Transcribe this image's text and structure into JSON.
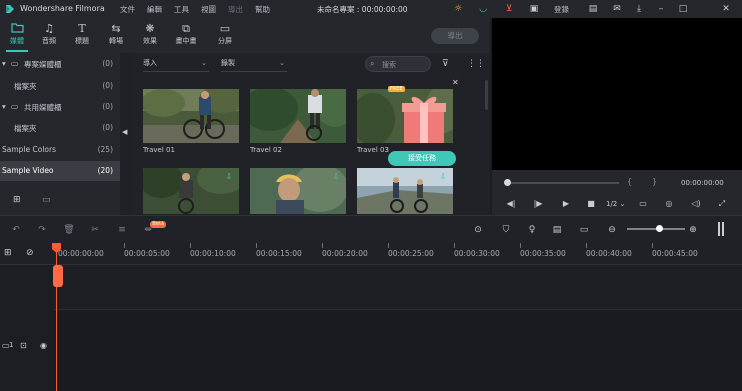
{
  "titlebar": {
    "app_name": "Wondershare Filmora",
    "menus": [
      "文件",
      "編輯",
      "工具",
      "視圖",
      "導出",
      "幫助"
    ],
    "project_title": "未命名專案 : 00:00:00:00",
    "login_label": "登錄"
  },
  "toolbar": {
    "tabs": [
      {
        "label": "媒體",
        "icon": "folder-icon"
      },
      {
        "label": "音頻",
        "icon": "music-note-icon"
      },
      {
        "label": "標題",
        "icon": "title-t-icon"
      },
      {
        "label": "轉場",
        "icon": "transition-icon"
      },
      {
        "label": "效果",
        "icon": "effects-icon"
      },
      {
        "label": "畫中畫",
        "icon": "pip-icon"
      },
      {
        "label": "分屏",
        "icon": "split-screen-icon"
      }
    ],
    "export_label": "導出"
  },
  "sidebar": {
    "items": [
      {
        "label": "專案媒體櫃",
        "count": "(0)"
      },
      {
        "label": "檔案夾",
        "count": "(0)"
      },
      {
        "label": "共用媒體櫃",
        "count": "(0)"
      },
      {
        "label": "檔案夾",
        "count": "(0)"
      },
      {
        "label": "Sample Colors",
        "count": "(25)"
      },
      {
        "label": "Sample Video",
        "count": "(20)"
      }
    ]
  },
  "media": {
    "import_label": "導入",
    "record_label": "錄製",
    "search_placeholder": "搜索",
    "thumbnails": [
      {
        "label": "Travel 01"
      },
      {
        "label": "Travel 02"
      },
      {
        "label": "Travel 03"
      },
      {
        "label": ""
      },
      {
        "label": ""
      },
      {
        "label": ""
      }
    ],
    "promo": {
      "badge": "FREE",
      "button_label": "接受任務"
    }
  },
  "preview": {
    "timecode": "00:00:00:00",
    "quality": "1/2"
  },
  "ruler": {
    "ticks": [
      "00:00:00:00",
      "00:00:05:00",
      "00:00:10:00",
      "00:00:15:00",
      "00:00:20:00",
      "00:00:25:00",
      "00:00:30:00",
      "00:00:35:00",
      "00:00:40:00",
      "00:00:45:00"
    ]
  },
  "timeline": {
    "beta_badge": "Beta",
    "track_number": "1"
  },
  "colors": {
    "accent": "#3fc7b8",
    "playhead": "#ff5a32"
  }
}
